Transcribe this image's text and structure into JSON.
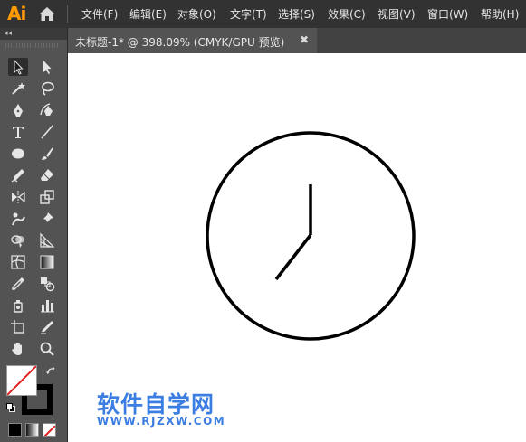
{
  "app": {
    "logo": "Ai"
  },
  "menu": {
    "items": [
      "文件(F)",
      "编辑(E)",
      "对象(O)",
      "文字(T)",
      "选择(S)",
      "效果(C)",
      "视图(V)",
      "窗口(W)",
      "帮助(H)"
    ]
  },
  "panel": {
    "collapse": "◂◂"
  },
  "tab": {
    "title": "未标题-1* @ 398.09% (CMYK/GPU 预览)",
    "close": "✖"
  },
  "colors": {
    "accent": "#FF9A00",
    "menubar_bg": "#323232",
    "toolbar_bg": "#535353",
    "canvas_bg": "#FFFFFF",
    "watermark": "#3B7DE0"
  },
  "artwork": {
    "description_icon": "clock-icon"
  },
  "watermark": {
    "title": "软件自学网",
    "url": "WWW.RJZXW.COM"
  }
}
